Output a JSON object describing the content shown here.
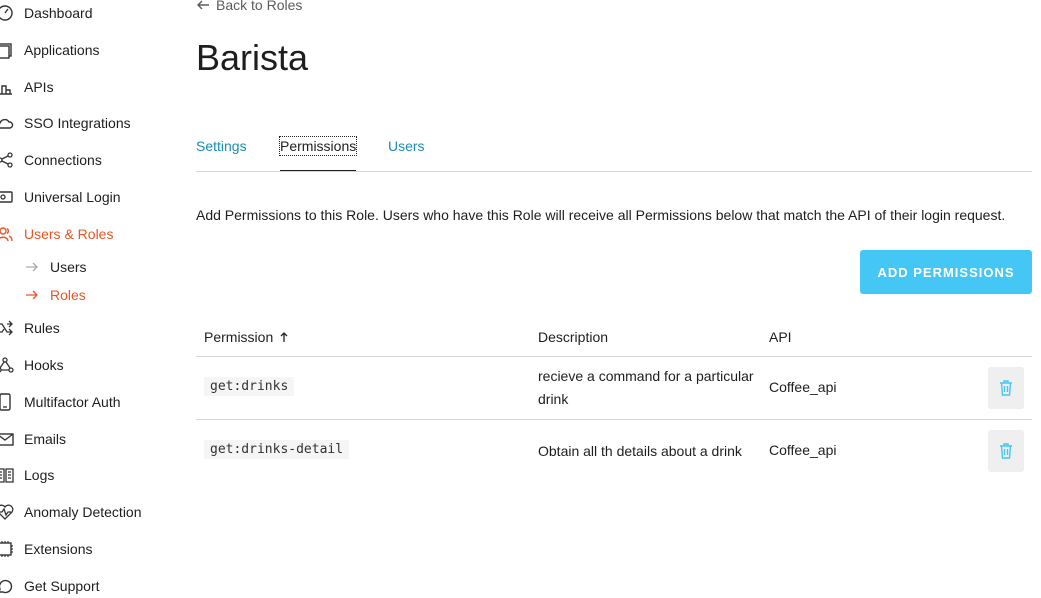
{
  "sidebar": {
    "items": [
      {
        "label": "Dashboard",
        "icon": "dashboard-icon"
      },
      {
        "label": "Applications",
        "icon": "applications-icon"
      },
      {
        "label": "APIs",
        "icon": "apis-icon"
      },
      {
        "label": "SSO Integrations",
        "icon": "cloud-icon"
      },
      {
        "label": "Connections",
        "icon": "connections-icon"
      },
      {
        "label": "Universal Login",
        "icon": "login-icon"
      },
      {
        "label": "Users & Roles",
        "icon": "users-icon",
        "active": true
      },
      {
        "label": "Rules",
        "icon": "rules-icon"
      },
      {
        "label": "Hooks",
        "icon": "hooks-icon"
      },
      {
        "label": "Multifactor Auth",
        "icon": "mfa-icon"
      },
      {
        "label": "Emails",
        "icon": "email-icon"
      },
      {
        "label": "Logs",
        "icon": "logs-icon"
      },
      {
        "label": "Anomaly Detection",
        "icon": "heart-icon"
      },
      {
        "label": "Extensions",
        "icon": "extensions-icon"
      },
      {
        "label": "Get Support",
        "icon": "support-icon"
      }
    ],
    "sub_items": [
      {
        "label": "Users"
      },
      {
        "label": "Roles",
        "active": true
      }
    ],
    "accent_color": "#eb5424"
  },
  "header": {
    "back_label": "Back to Roles",
    "title": "Barista"
  },
  "tabs": [
    {
      "label": "Settings"
    },
    {
      "label": "Permissions",
      "active": true
    },
    {
      "label": "Users"
    }
  ],
  "info_text": "Add Permissions to this Role. Users who have this Role will receive all Permissions below that match the API of their login request.",
  "add_button_label": "ADD PERMISSIONS",
  "table": {
    "columns": [
      "Permission",
      "Description",
      "API"
    ],
    "rows": [
      {
        "permission": "get:drinks",
        "description": "recieve a command for a particular drink",
        "api": "Coffee_api"
      },
      {
        "permission": "get:drinks-detail",
        "description": "Obtain all th details about a drink",
        "api": "Coffee_api"
      }
    ]
  },
  "colors": {
    "link": "#1a8fb0",
    "button": "#44c7f4",
    "delete_icon": "#44c7f4"
  }
}
